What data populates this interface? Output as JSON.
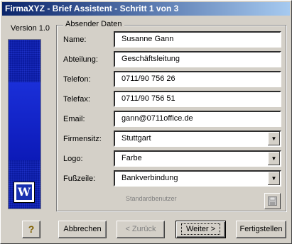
{
  "window": {
    "title": "FirmaXYZ - Brief Assistent - Schritt 1 von 3"
  },
  "sidebar": {
    "version": "Version 1.0",
    "logo_letter": "W"
  },
  "group": {
    "legend": "Absender Daten"
  },
  "fields": {
    "name": {
      "label": "Name:",
      "value": "Susanne Gann"
    },
    "abteilung": {
      "label": "Abteilung:",
      "value": "Geschäftsleitung"
    },
    "telefon": {
      "label": "Telefon:",
      "value": "0711/90 756 26"
    },
    "telefax": {
      "label": "Telefax:",
      "value": "0711/90 756 51"
    },
    "email": {
      "label": "Email:",
      "value": "gann@0711office.de"
    },
    "firmensitz": {
      "label": "Firmensitz:",
      "value": "Stuttgart"
    },
    "logo": {
      "label": "Logo:",
      "value": "Farbe"
    },
    "fusszeile": {
      "label": "Fußzeile:",
      "value": "Bankverbindung"
    }
  },
  "standard_user_label": "Standardbenutzer",
  "icons": {
    "help": "help-icon",
    "save": "save-icon",
    "dropdown": "chevron-down-icon"
  },
  "buttons": {
    "help": "?",
    "abbrechen": "Abbrechen",
    "zurueck": "< Zurück",
    "weiter": "Weiter >",
    "fertigstellen": "Fertigstellen"
  }
}
